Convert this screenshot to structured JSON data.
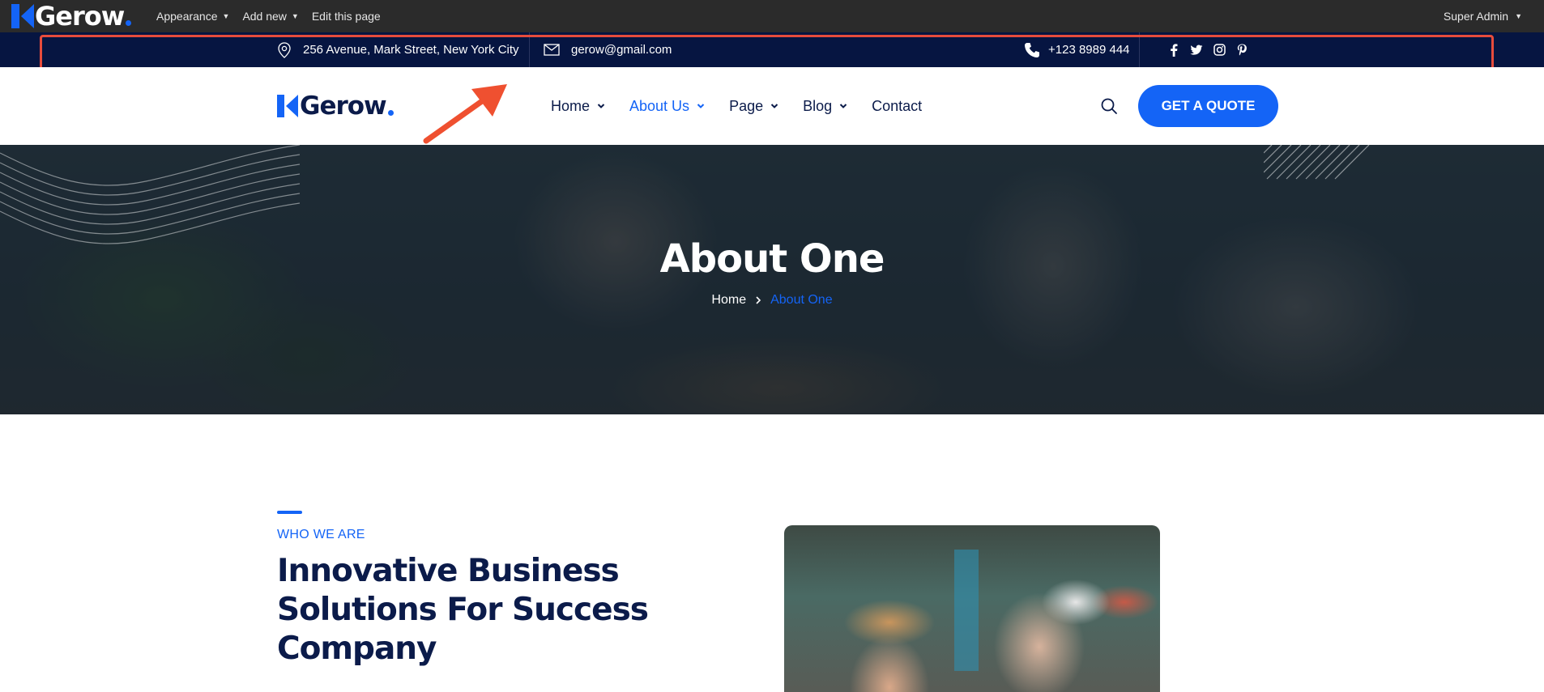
{
  "admin_bar": {
    "brand": "Gerow",
    "menu": [
      {
        "label": "Appearance",
        "has_dropdown": true
      },
      {
        "label": "Add new",
        "has_dropdown": true
      },
      {
        "label": "Edit this page",
        "has_dropdown": false
      }
    ],
    "user": "Super Admin"
  },
  "top_bar": {
    "address": "256 Avenue, Mark Street, New York City",
    "email": "gerow@gmail.com",
    "phone": "+123 8989 444",
    "social_icons": [
      "facebook-icon",
      "twitter-icon",
      "instagram-icon",
      "pinterest-icon"
    ]
  },
  "header": {
    "brand": "Gerow",
    "nav": [
      {
        "label": "Home",
        "has_dropdown": true,
        "active": false
      },
      {
        "label": "About Us",
        "has_dropdown": true,
        "active": true
      },
      {
        "label": "Page",
        "has_dropdown": true,
        "active": false
      },
      {
        "label": "Blog",
        "has_dropdown": true,
        "active": false
      },
      {
        "label": "Contact",
        "has_dropdown": false,
        "active": false
      }
    ],
    "cta": "GET A QUOTE"
  },
  "hero": {
    "title": "About One",
    "breadcrumb": {
      "home": "Home",
      "current": "About One"
    }
  },
  "about": {
    "eyebrow": "WHO WE ARE",
    "heading": "Innovative Business Solutions For Success Company"
  },
  "colors": {
    "accent": "#1464f6",
    "navy": "#0b1b4a",
    "top_bar": "#061541",
    "admin_bar": "#2b2b2b",
    "highlight": "#e74c3c"
  }
}
